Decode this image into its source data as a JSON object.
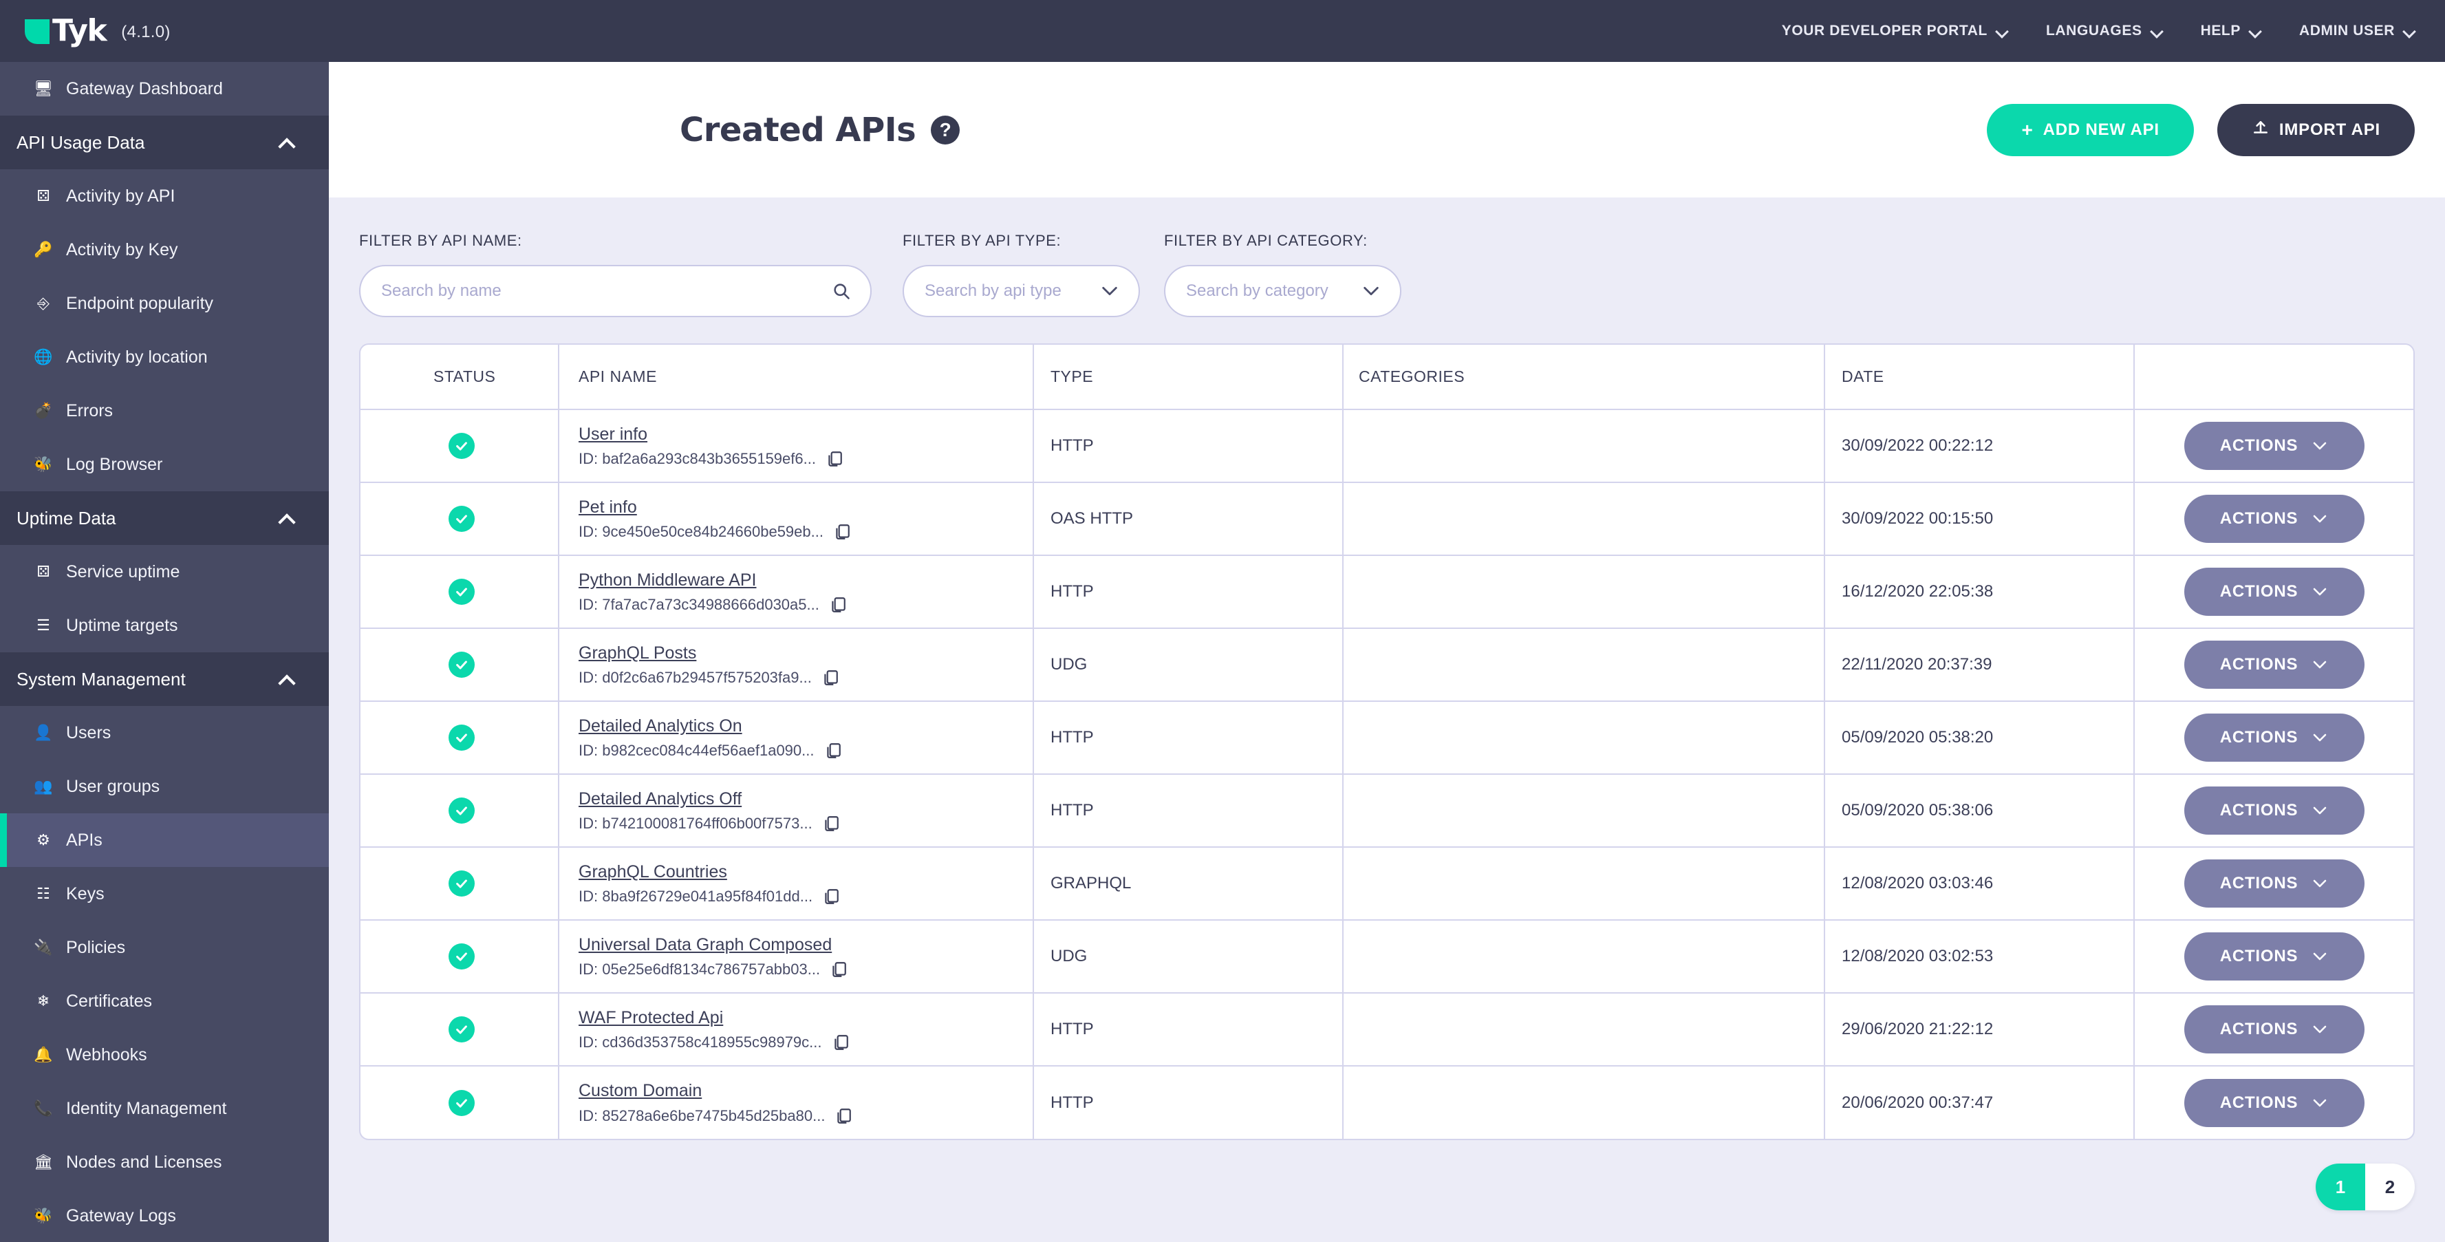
{
  "topbar": {
    "brand": "Tyk",
    "version": "(4.1.0)",
    "nav": [
      {
        "label": "YOUR DEVELOPER PORTAL"
      },
      {
        "label": "LANGUAGES"
      },
      {
        "label": "HELP"
      },
      {
        "label": "ADMIN USER"
      }
    ]
  },
  "sidebar": {
    "top_link": {
      "label": "Gateway Dashboard",
      "icon": "monitor-icon"
    },
    "sections": [
      {
        "title": "API Usage Data",
        "items": [
          {
            "label": "Activity by API",
            "icon": "molecule-icon"
          },
          {
            "label": "Activity by Key",
            "icon": "key-icon"
          },
          {
            "label": "Endpoint popularity",
            "icon": "branch-icon"
          },
          {
            "label": "Activity by location",
            "icon": "globe-icon"
          },
          {
            "label": "Errors",
            "icon": "bomb-icon"
          },
          {
            "label": "Log Browser",
            "icon": "bug-icon"
          }
        ]
      },
      {
        "title": "Uptime Data",
        "items": [
          {
            "label": "Service uptime",
            "icon": "molecule-icon"
          },
          {
            "label": "Uptime targets",
            "icon": "list-icon"
          }
        ]
      },
      {
        "title": "System Management",
        "items": [
          {
            "label": "Users",
            "icon": "user-icon"
          },
          {
            "label": "User groups",
            "icon": "users-icon"
          },
          {
            "label": "APIs",
            "icon": "gears-icon",
            "active": true
          },
          {
            "label": "Keys",
            "icon": "sitemap-icon"
          },
          {
            "label": "Policies",
            "icon": "plug-icon"
          },
          {
            "label": "Certificates",
            "icon": "certificate-icon"
          },
          {
            "label": "Webhooks",
            "icon": "bell-icon"
          },
          {
            "label": "Identity Management",
            "icon": "phone-icon"
          },
          {
            "label": "Nodes and Licenses",
            "icon": "bank-icon"
          },
          {
            "label": "Gateway Logs",
            "icon": "bug-icon"
          }
        ]
      }
    ]
  },
  "page": {
    "title": "Created APIs",
    "help_badge": "?",
    "add_button": {
      "label": "ADD NEW API",
      "glyph": "+",
      "color": "#0bd8ac"
    },
    "import_button": {
      "label": "IMPORT API",
      "icon": "upload-icon",
      "color": "#373a50"
    }
  },
  "filters": [
    {
      "label": "FILTER BY API NAME:",
      "placeholder": "Search by name",
      "icon": "search-icon"
    },
    {
      "label": "FILTER BY API TYPE:",
      "placeholder": "Search by api type",
      "icon": "chevron-down-icon"
    },
    {
      "label": "FILTER BY API CATEGORY:",
      "placeholder": "Search by category",
      "icon": "chevron-down-icon"
    }
  ],
  "table": {
    "columns": [
      "STATUS",
      "API NAME",
      "TYPE",
      "CATEGORIES",
      "DATE"
    ],
    "actions_label": "ACTIONS",
    "id_prefix": "ID: ",
    "rows": [
      {
        "status": "active",
        "name": "User info",
        "id": "baf2a6a293c843b3655159ef6...",
        "type": "HTTP",
        "categories": "",
        "date": "30/09/2022 00:22:12"
      },
      {
        "status": "active",
        "name": "Pet info",
        "id": "9ce450e50ce84b24660be59eb...",
        "type": "OAS HTTP",
        "categories": "",
        "date": "30/09/2022 00:15:50"
      },
      {
        "status": "active",
        "name": "Python Middleware API",
        "id": "7fa7ac7a73c34988666d030a5...",
        "type": "HTTP",
        "categories": "",
        "date": "16/12/2020 22:05:38"
      },
      {
        "status": "active",
        "name": "GraphQL Posts",
        "id": "d0f2c6a67b29457f575203fa9...",
        "type": "UDG",
        "categories": "",
        "date": "22/11/2020 20:37:39"
      },
      {
        "status": "active",
        "name": "Detailed Analytics On",
        "id": "b982cec084c44ef56aef1a090...",
        "type": "HTTP",
        "categories": "",
        "date": "05/09/2020 05:38:20"
      },
      {
        "status": "active",
        "name": "Detailed Analytics Off",
        "id": "b742100081764ff06b00f7573...",
        "type": "HTTP",
        "categories": "",
        "date": "05/09/2020 05:38:06"
      },
      {
        "status": "active",
        "name": "GraphQL Countries",
        "id": "8ba9f26729e041a95f84f01dd...",
        "type": "GRAPHQL",
        "categories": "",
        "date": "12/08/2020 03:03:46"
      },
      {
        "status": "active",
        "name": "Universal Data Graph Composed",
        "id": "05e25e6df8134c786757abb03...",
        "type": "UDG",
        "categories": "",
        "date": "12/08/2020 03:02:53"
      },
      {
        "status": "active",
        "name": "WAF Protected Api",
        "id": "cd36d353758c418955c98979c...",
        "type": "HTTP",
        "categories": "",
        "date": "29/06/2020 21:22:12"
      },
      {
        "status": "active",
        "name": "Custom Domain",
        "id": "85278a6e6be7475b45d25ba80...",
        "type": "HTTP",
        "categories": "",
        "date": "20/06/2020 00:37:47"
      }
    ]
  },
  "pagination": {
    "pages": [
      "1",
      "2"
    ],
    "current": "1"
  },
  "colors": {
    "accent_teal": "#0bd8ac",
    "dark_navy": "#373a50",
    "sidebar": "#474a63",
    "panel_bg": "#ececf7",
    "actions_purple": "#7d7fa9"
  }
}
